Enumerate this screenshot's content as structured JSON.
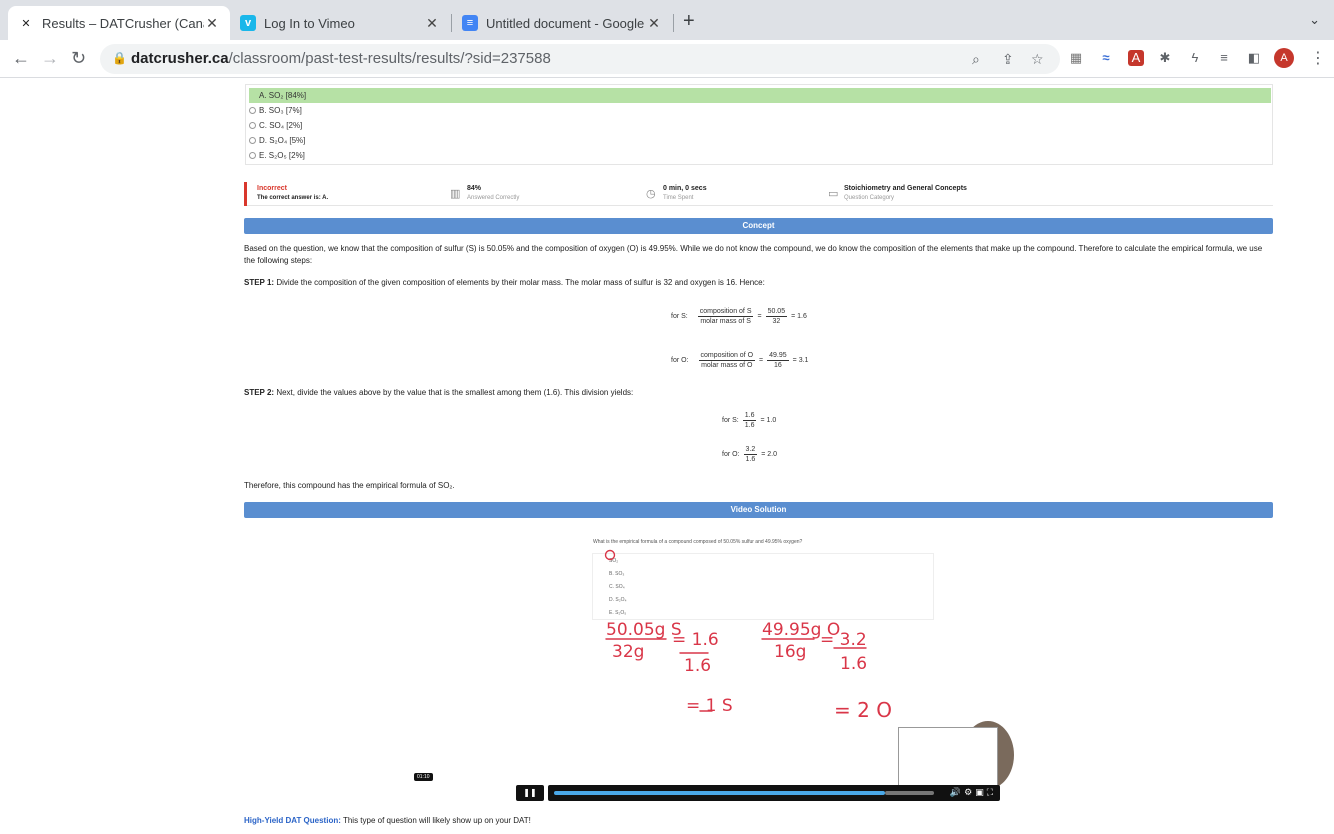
{
  "browser": {
    "tabs": [
      {
        "title": "Results – DATCrusher (Canada",
        "favicon": "X",
        "active": true
      },
      {
        "title": "Log In to Vimeo",
        "favicon": "v",
        "active": false
      },
      {
        "title": "Untitled document - Google Do",
        "favicon": "≡",
        "active": false
      }
    ],
    "url_domain": "datcrusher.ca",
    "url_path": "/classroom/past-test-results/results/?sid=237588",
    "avatar_letter": "A"
  },
  "answer_options": [
    {
      "label": "A. SO₂ [84%]",
      "correct": true
    },
    {
      "label": "B. SO₃ [7%]",
      "correct": false
    },
    {
      "label": "C. SO₄ [2%]",
      "correct": false
    },
    {
      "label": "D. S₂O₄ [5%]",
      "correct": false
    },
    {
      "label": "E. S₂O₅ [2%]",
      "correct": false
    }
  ],
  "result": {
    "status": "Incorrect",
    "correct_answer": "The correct answer is: A.",
    "percent": "84%",
    "percent_label": "Answered Correctly",
    "time": "0 min, 0 secs",
    "time_label": "Time Spent",
    "category": "Stoichiometry and General Concepts",
    "category_label": "Question Category"
  },
  "concept": {
    "header": "Concept",
    "intro": "Based on the question, we know that the composition of sulfur (S) is 50.05% and the composition of oxygen (O) is 49.95%. While we do not know the compound, we do know the composition of the elements that make up the compound. Therefore to calculate the empirical formula, we use the following steps:",
    "step1_label": "STEP 1:",
    "step1_text": " Divide the composition of the given composition of elements by their molar mass. The molar mass of sulfur is 32 and oxygen is 16. Hence:",
    "eq1": {
      "prefix": "for S:",
      "num": "composition of S",
      "den": "molar mass of S",
      "num2": "50.05",
      "den2": "32",
      "result": "= 1.6"
    },
    "eq2": {
      "prefix": "for O:",
      "num": "composition of O",
      "den": "molar mass of O",
      "num2": "49.95",
      "den2": "16",
      "result": "= 3.1"
    },
    "step2_label": "STEP 2:",
    "step2_text": " Next, divide the values above by the value that is the smallest among them (1.6). This division yields:",
    "eq3": {
      "prefix": "for S:",
      "num": "1.6",
      "den": "1.6",
      "result": "= 1.0"
    },
    "eq4": {
      "prefix": "for O:",
      "num": "3.2",
      "den": "1.6",
      "result": "= 2.0"
    },
    "conclusion": "Therefore, this compound has the empirical formula of SO₂."
  },
  "video": {
    "header": "Video Solution",
    "question": "What is the empirical formula of a compound composed of 50.05% sulfur and 49.95% oxygen?",
    "options": [
      "SO₂",
      "B. SO₃",
      "C. SO₄",
      "D. S₂O₄",
      "E. S₂O₅"
    ],
    "hw1": "50.05g S",
    "hw1_den": "32g",
    "hw1_res": "= 1.6",
    "hw1_res_den": "1.6",
    "hw2": "49.95g O",
    "hw2_den": "16g",
    "hw2_res": "= 3.2",
    "hw2_res_den": "1.6",
    "hw3": "= 1 S",
    "hw4": "= 2 O",
    "time": "01:10",
    "progress": 0.87
  },
  "footer": {
    "highlight": "High-Yield DAT Question:",
    "text": " This type of question will likely show up on your DAT!"
  }
}
